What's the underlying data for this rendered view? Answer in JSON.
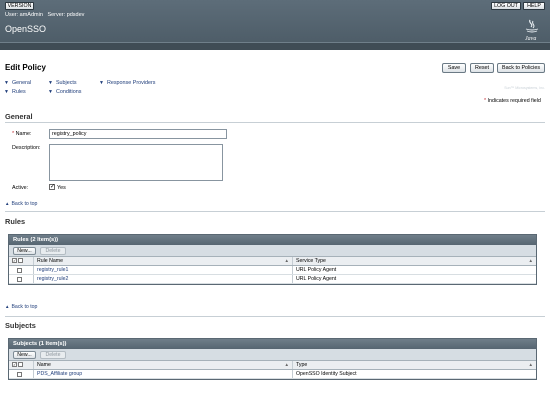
{
  "header": {
    "version_label": "VERSION",
    "logout_label": "LOG OUT",
    "help_label": "HELP",
    "user_text": "User: amAdmin",
    "server_text": "Server: pdsdev",
    "product_name": "OpenSSO",
    "java_logo_text": "Java",
    "company_note": "Sun™ Microsystems, Inc."
  },
  "page": {
    "title": "Edit Policy",
    "save_label": "Save",
    "reset_label": "Reset",
    "back_label": "Back to Policies",
    "jump_links": {
      "general": "General",
      "subjects": "Subjects",
      "responders": "Response Providers",
      "rules": "Rules",
      "conditions": "Conditions"
    },
    "required_note": "Indicates required field",
    "back_to_top": "Back to top"
  },
  "general": {
    "title": "General",
    "name_label": "Name:",
    "name_value": "registry_policy",
    "description_label": "Description:",
    "description_value": "",
    "active_label": "Active:",
    "active_option": "Yes",
    "active_checked": true
  },
  "rules": {
    "section_title": "Rules",
    "table_title": "Rules (2 Item(s))",
    "new_label": "New...",
    "delete_label": "Delete",
    "col_name": "Rule Name",
    "col_type": "Service Type",
    "rows": [
      {
        "name": "registry_rule1",
        "type": "URL Policy Agent"
      },
      {
        "name": "registry_rule2",
        "type": "URL Policy Agent"
      }
    ]
  },
  "subjects": {
    "section_title": "Subjects",
    "table_title": "Subjects (1 Item(s))",
    "new_label": "New...",
    "delete_label": "Delete",
    "col_name": "Name",
    "col_type": "Type",
    "rows": [
      {
        "name": "PDS_Affiliate group",
        "type": "OpenSSO Identity Subject"
      }
    ]
  },
  "colors": {
    "header_bg": "#4f5e69",
    "link": "#1f3d7a",
    "required_star": "#c0262f",
    "table_title_bg": "#5f6e79"
  }
}
